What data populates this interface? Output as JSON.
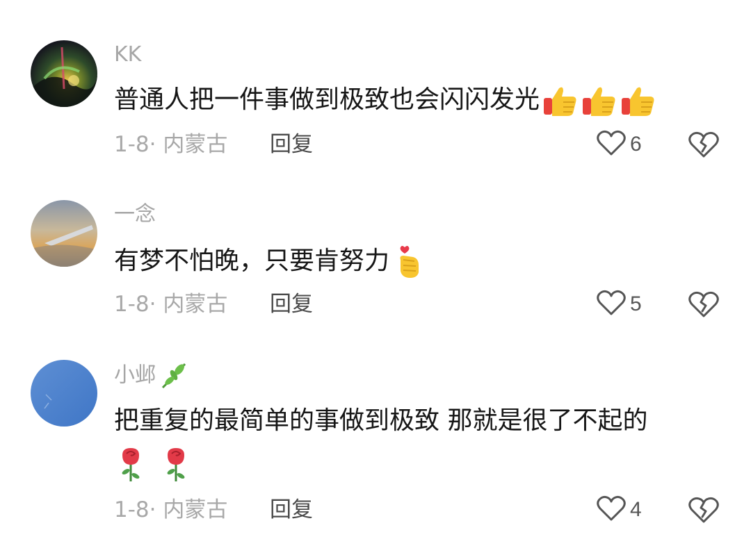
{
  "comments": [
    {
      "username": "KK",
      "text": "普通人把一件事做到极致也会闪闪发光",
      "trailing_emojis": [
        "thumbs-up",
        "thumbs-up",
        "thumbs-up"
      ],
      "meta": "1-8· 内蒙古",
      "reply_label": "回复",
      "likes": "6",
      "avatar": "aurora-night-photo"
    },
    {
      "username": "一念",
      "text": "有梦不怕晚，只要肯努力",
      "trailing_emojis": [
        "finger-heart"
      ],
      "meta": "1-8· 内蒙古",
      "reply_label": "回复",
      "likes": "5",
      "avatar": "sunset-airplane-photo"
    },
    {
      "username": "小邺",
      "username_emoji": "herb",
      "text": "把重复的最简单的事做到极致 那就是很了不起的",
      "trailing_emojis": [
        "rose",
        "rose"
      ],
      "meta": "1-8· 内蒙古",
      "reply_label": "回复",
      "likes": "4",
      "avatar": "blue-sky-photo"
    }
  ],
  "colors": {
    "username": "#a6a6a6",
    "text": "#161616",
    "meta": "#a8a8a8",
    "reply": "#4a4a4a",
    "icon": "#555555"
  },
  "icons": {
    "like": "heart-outline-icon",
    "dislike": "broken-heart-icon"
  }
}
